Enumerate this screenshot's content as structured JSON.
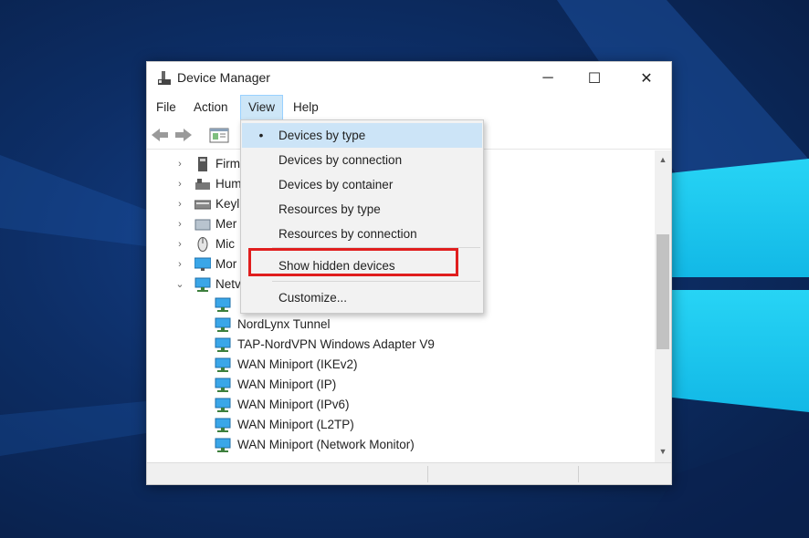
{
  "window": {
    "title": "Device Manager",
    "icon": "device-manager-icon"
  },
  "window_controls": {
    "minimize": "─",
    "maximize": "☐",
    "close": "✕"
  },
  "menubar": {
    "items": [
      "File",
      "Action",
      "View",
      "Help"
    ],
    "active_index": 2
  },
  "toolbar": {
    "icons": [
      "back-arrow-icon",
      "forward-arrow-icon",
      "properties-icon"
    ]
  },
  "tree": {
    "collapsed_categories": [
      {
        "label": "Firm",
        "icon": "firmware-icon",
        "expanded": false
      },
      {
        "label": "Hum",
        "icon": "human-interface-icon",
        "expanded": false
      },
      {
        "label": "Keyl",
        "icon": "keyboard-icon",
        "expanded": false
      },
      {
        "label": "Mer",
        "icon": "memory-icon",
        "expanded": false
      },
      {
        "label": "Mic",
        "icon": "mouse-icon",
        "expanded": false
      },
      {
        "label": "Mor",
        "icon": "monitor-icon",
        "expanded": false
      },
      {
        "label": "Netv",
        "icon": "network-icon",
        "expanded": true
      }
    ],
    "network_adapters": [
      "NordLynx Tunnel",
      "TAP-NordVPN Windows Adapter V9",
      "WAN Miniport (IKEv2)",
      "WAN Miniport (IP)",
      "WAN Miniport (IPv6)",
      "WAN Miniport (L2TP)",
      "WAN Miniport (Network Monitor)"
    ]
  },
  "view_menu": {
    "items": [
      {
        "label": "Devices by type",
        "checked": true
      },
      {
        "label": "Devices by connection",
        "checked": false
      },
      {
        "label": "Devices by container",
        "checked": false
      },
      {
        "label": "Resources by type",
        "checked": false
      },
      {
        "label": "Resources by connection",
        "checked": false
      },
      {
        "label": "Show hidden devices",
        "checked": false,
        "highlighted": true
      },
      {
        "label": "Customize...",
        "checked": false
      }
    ],
    "checked_marker": "•",
    "highlight_color": "#e01e1e"
  },
  "colors": {
    "desktop": "#0d2e66",
    "logo": "#1fc6ee",
    "menu_active": "#cde6f7"
  }
}
